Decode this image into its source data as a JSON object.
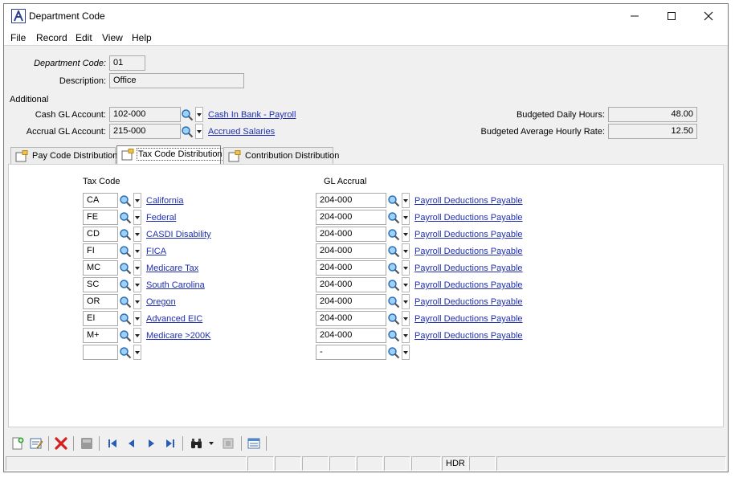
{
  "window": {
    "title": "Department Code"
  },
  "menu": [
    "File",
    "Record",
    "Edit",
    "View",
    "Help"
  ],
  "header": {
    "dept_code_label": "Department Code:",
    "dept_code_value": "01",
    "description_label": "Description:",
    "description_value": "Office"
  },
  "additional": {
    "section_label": "Additional",
    "cash_gl_label": "Cash GL Account:",
    "cash_gl_value": "102-000",
    "cash_gl_link": "Cash In Bank - Payroll",
    "accrual_gl_label": "Accrual GL Account:",
    "accrual_gl_value": "215-000",
    "accrual_gl_link": "Accrued Salaries",
    "daily_hours_label": "Budgeted Daily Hours:",
    "daily_hours_value": "48.00",
    "avg_rate_label": "Budgeted Average Hourly Rate:",
    "avg_rate_value": "12.50"
  },
  "tabs": [
    {
      "label": "Pay Code Distribution",
      "active": false
    },
    {
      "label": "Tax Code Distribution",
      "active": true
    },
    {
      "label": "Contribution Distribution",
      "active": false
    }
  ],
  "grid": {
    "tax_code_header": "Tax Code",
    "gl_accrual_header": "GL Accrual",
    "rows": [
      {
        "code": "CA",
        "name": "California",
        "gl": "204-000",
        "gl_name": "Payroll Deductions Payable"
      },
      {
        "code": "FE",
        "name": "Federal",
        "gl": "204-000",
        "gl_name": "Payroll Deductions Payable"
      },
      {
        "code": "CD",
        "name": "CASDI Disability",
        "gl": "204-000",
        "gl_name": "Payroll Deductions Payable"
      },
      {
        "code": "FI",
        "name": "FICA",
        "gl": "204-000",
        "gl_name": "Payroll Deductions Payable"
      },
      {
        "code": "MC",
        "name": "Medicare Tax",
        "gl": "204-000",
        "gl_name": "Payroll Deductions Payable"
      },
      {
        "code": "SC",
        "name": "South Carolina",
        "gl": "204-000",
        "gl_name": "Payroll Deductions Payable"
      },
      {
        "code": "OR",
        "name": "Oregon",
        "gl": "204-000",
        "gl_name": "Payroll Deductions Payable"
      },
      {
        "code": "EI",
        "name": "Advanced EIC",
        "gl": "204-000",
        "gl_name": "Payroll Deductions Payable"
      },
      {
        "code": "M+",
        "name": "Medicare >200K",
        "gl": "204-000",
        "gl_name": "Payroll Deductions Payable"
      },
      {
        "code": "",
        "name": "",
        "gl": "-",
        "gl_name": ""
      }
    ]
  },
  "toolbar_icons": [
    "new-record-icon",
    "edit-record-icon",
    "delete-icon",
    "save-icon",
    "first-record-icon",
    "previous-record-icon",
    "next-record-icon",
    "last-record-icon",
    "find-icon",
    "find-dropdown-icon",
    "notes-icon",
    "layout-icon"
  ],
  "status": {
    "mode": "HDR"
  },
  "colors": {
    "link": "#1f2fb0",
    "field_bg": "#f0f0f0",
    "window_bg": "#f0f0f0",
    "delete_red": "#d62020"
  }
}
